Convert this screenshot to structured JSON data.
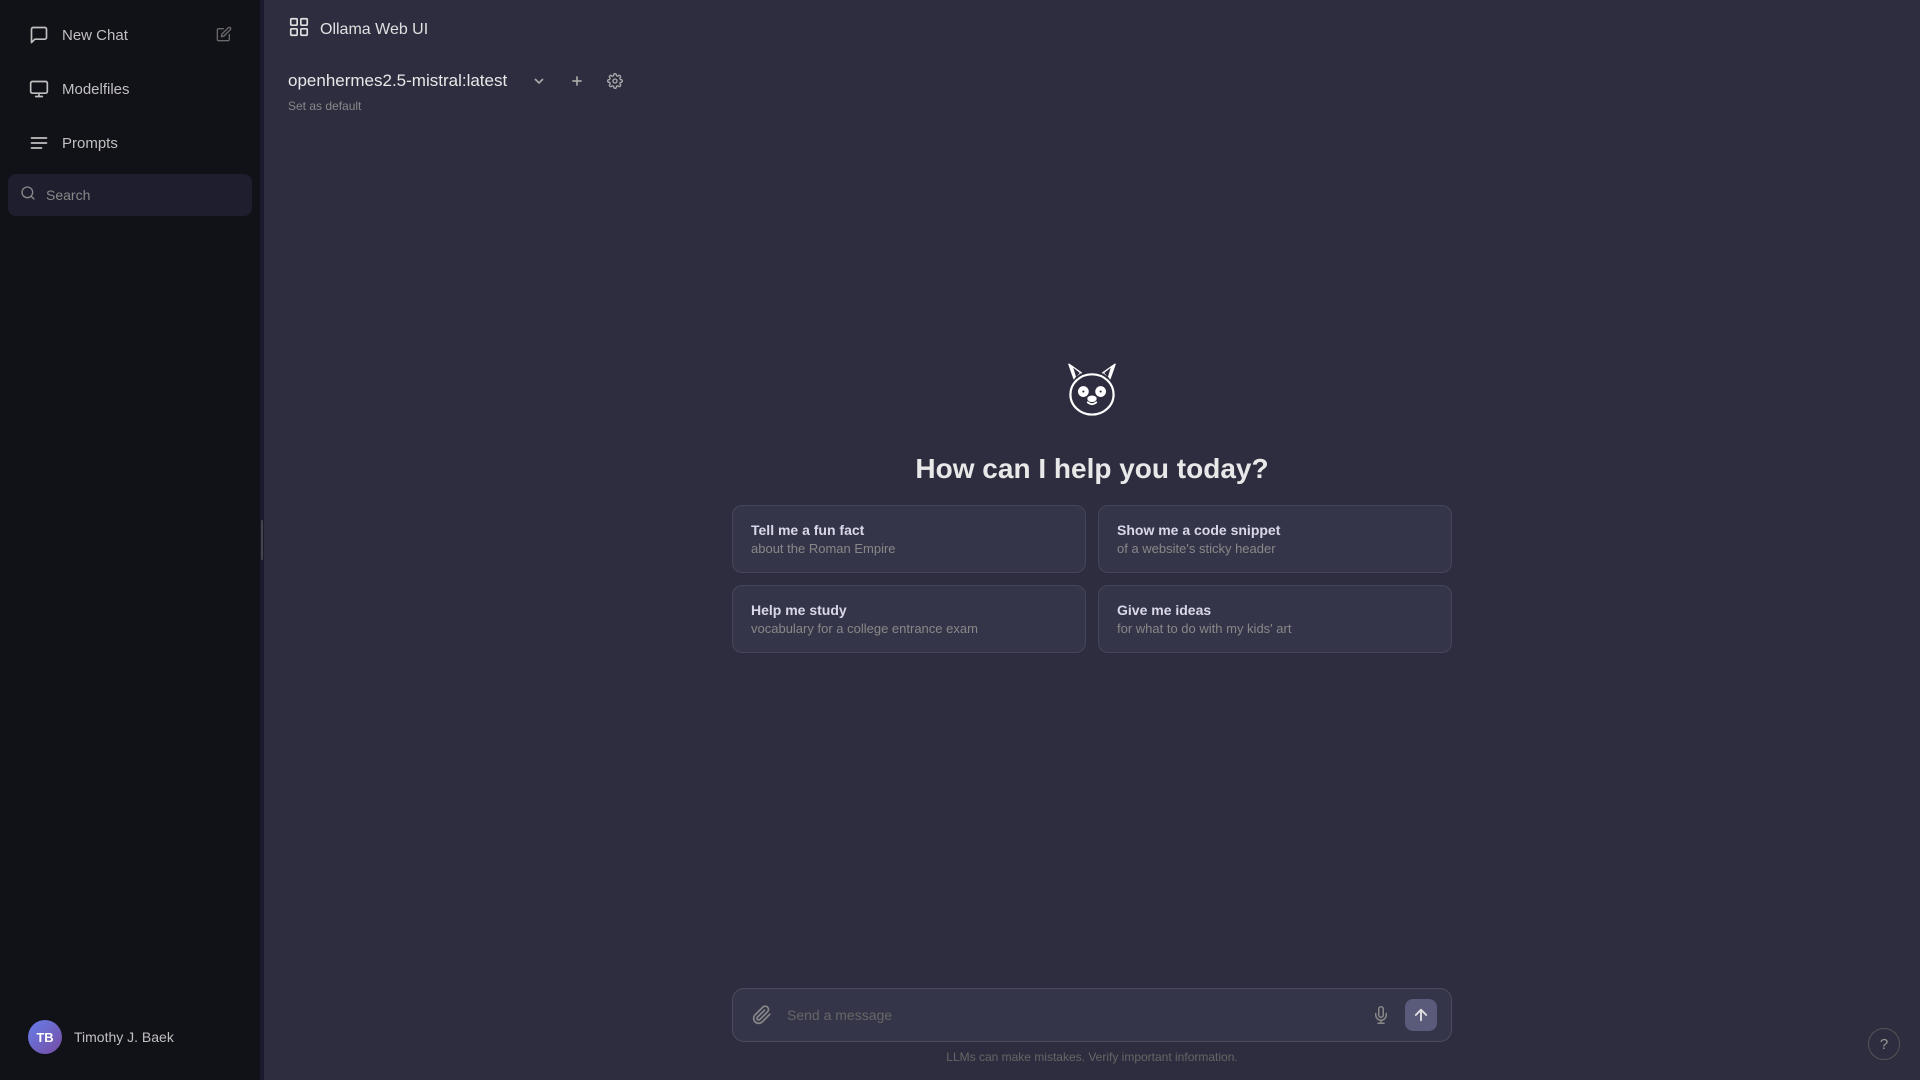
{
  "sidebar": {
    "new_chat_label": "New Chat",
    "modelfiles_label": "Modelfiles",
    "prompts_label": "Prompts",
    "search_placeholder": "Search",
    "user": {
      "name": "Timothy J. Baek",
      "initials": "TB"
    }
  },
  "topbar": {
    "app_name": "Ollama Web UI"
  },
  "model": {
    "name": "openhermes2.5-mistral:latest",
    "set_default_label": "Set as default"
  },
  "welcome": {
    "text": "How can I help you today?"
  },
  "suggestions": [
    {
      "title": "Tell me a fun fact",
      "subtitle": "about the Roman Empire"
    },
    {
      "title": "Show me a code snippet",
      "subtitle": "of a website's sticky header"
    },
    {
      "title": "Help me study",
      "subtitle": "vocabulary for a college entrance exam"
    },
    {
      "title": "Give me ideas",
      "subtitle": "for what to do with my kids' art"
    }
  ],
  "input": {
    "placeholder": "Send a message"
  },
  "disclaimer": "LLMs can make mistakes. Verify important information."
}
